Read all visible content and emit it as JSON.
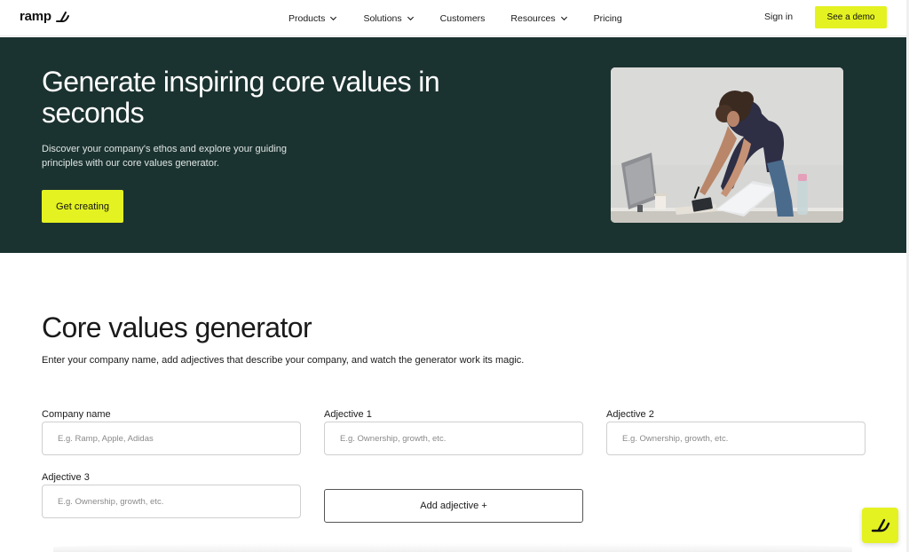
{
  "nav": {
    "logo_text": "ramp",
    "logo_icon": "ramp-logo-icon",
    "items": [
      {
        "label": "Products",
        "has_dropdown": true
      },
      {
        "label": "Solutions",
        "has_dropdown": true
      },
      {
        "label": "Customers",
        "has_dropdown": false
      },
      {
        "label": "Resources",
        "has_dropdown": true
      },
      {
        "label": "Pricing",
        "has_dropdown": false
      }
    ],
    "signin_label": "Sign in",
    "demo_label": "See a demo"
  },
  "hero": {
    "title": "Generate inspiring core values in seconds",
    "description": "Discover your company's ethos and explore your guiding principles with our core values generator.",
    "cta_label": "Get creating",
    "image_icon": "woman-working-at-desk-photo"
  },
  "generator": {
    "title": "Core values generator",
    "description": "Enter your company name, add adjectives that describe your company, and watch the generator work its magic.",
    "fields": [
      {
        "label": "Company name",
        "placeholder": "E.g. Ramp, Apple, Adidas",
        "value": ""
      },
      {
        "label": "Adjective 1",
        "placeholder": "E.g. Ownership, growth, etc.",
        "value": ""
      },
      {
        "label": "Adjective 2",
        "placeholder": "E.g. Ownership, growth, etc.",
        "value": ""
      },
      {
        "label": "Adjective 3",
        "placeholder": "E.g. Ownership, growth, etc.",
        "value": ""
      }
    ],
    "add_label": "Add adjective +"
  },
  "colors": {
    "accent": "#e4f221",
    "hero_bg": "#1b3330"
  },
  "chat_icon": "ramp-chat-icon"
}
